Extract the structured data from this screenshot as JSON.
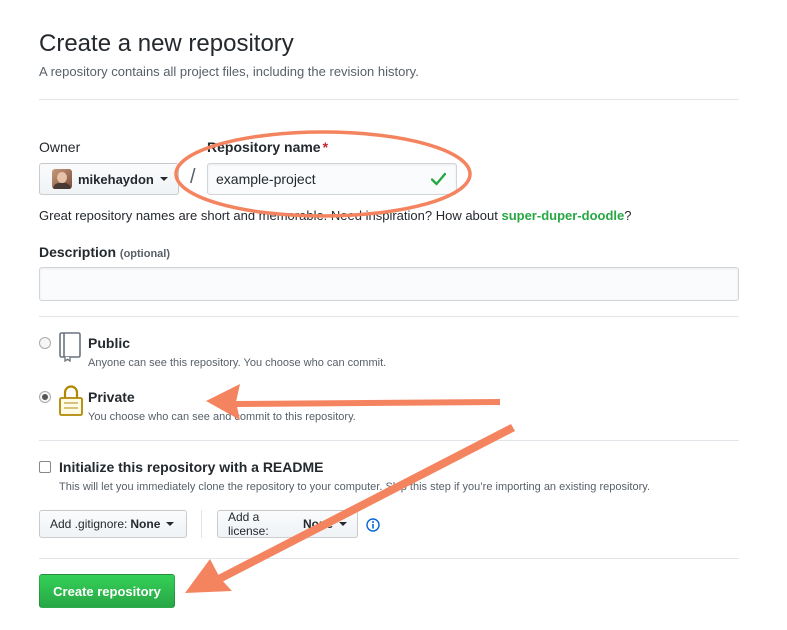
{
  "page": {
    "title": "Create a new repository",
    "subtitle": "A repository contains all project files, including the revision history."
  },
  "owner": {
    "label": "Owner",
    "selected": "mikehaydon",
    "separator": "/"
  },
  "repo_name": {
    "label": "Repository name",
    "required_mark": "*",
    "value": "example-project"
  },
  "hint": {
    "prefix": "Great repository names are short and memorable. Need inspiration? How about ",
    "suggestion": "super-duper-doodle",
    "suffix": "?"
  },
  "description": {
    "label": "Description",
    "optional": "(optional)",
    "value": ""
  },
  "visibility": {
    "public": {
      "label": "Public",
      "note": "Anyone can see this repository. You choose who can commit.",
      "selected": false
    },
    "private": {
      "label": "Private",
      "note": "You choose who can see and commit to this repository.",
      "selected": true
    }
  },
  "readme": {
    "label": "Initialize this repository with a README",
    "note": "This will let you immediately clone the repository to your computer. Skip this step if you’re importing an existing repository.",
    "checked": false
  },
  "gitignore": {
    "label": "Add .gitignore:",
    "value": "None"
  },
  "license": {
    "label": "Add a license:",
    "value": "None"
  },
  "submit": {
    "label": "Create repository"
  },
  "colors": {
    "annotation": "#f4845f",
    "accent_green": "#28a745",
    "check": "#28a745"
  },
  "icons": {
    "valid": "check-icon",
    "public": "repo-book-icon",
    "private": "lock-icon",
    "info": "info-icon"
  }
}
